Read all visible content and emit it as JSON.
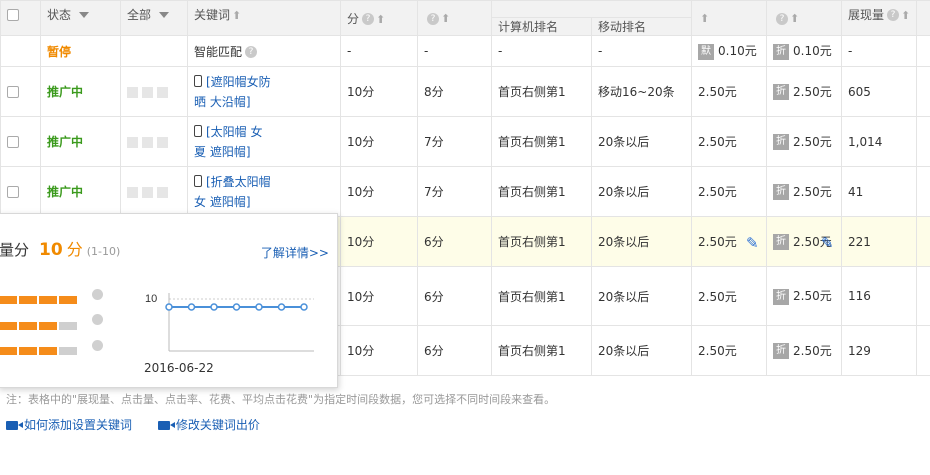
{
  "header": {
    "status": "状态",
    "all": "全部",
    "keyword": "关键词",
    "score": "分",
    "pc_rank": "计算机排名",
    "mobile_rank": "移动排名",
    "impressions": "展现量"
  },
  "rows": [
    {
      "status": "暂停",
      "keyword": "智能匹配",
      "pc_score": "-",
      "mobile_score": "-",
      "pc_rank": "-",
      "mobile_rank": "-",
      "pc_bid_tag": "默",
      "pc_bid": "0.10元",
      "mobile_bid_tag": "折",
      "mobile_bid": "0.10元",
      "impressions": "-"
    },
    {
      "status": "推广中",
      "keyword": "[遮阳帽女防晒 大沿帽]",
      "pc_score": "10分",
      "mobile_score": "8分",
      "pc_rank": "首页右侧第1",
      "mobile_rank": "移动16~20条",
      "pc_bid": "2.50元",
      "mobile_bid_tag": "折",
      "mobile_bid": "2.50元",
      "impressions": "605"
    },
    {
      "status": "推广中",
      "keyword": "[太阳帽 女夏 遮阳帽]",
      "pc_score": "10分",
      "mobile_score": "7分",
      "pc_rank": "首页右侧第1",
      "mobile_rank": "20条以后",
      "pc_bid": "2.50元",
      "mobile_bid_tag": "折",
      "mobile_bid": "2.50元",
      "impressions": "1,014"
    },
    {
      "status": "推广中",
      "keyword": "[折叠太阳帽女 遮阳帽]",
      "pc_score": "10分",
      "mobile_score": "7分",
      "pc_rank": "首页右侧第1",
      "mobile_rank": "20条以后",
      "pc_bid": "2.50元",
      "mobile_bid_tag": "折",
      "mobile_bid": "2.50元",
      "impressions": "41"
    },
    {
      "status": "",
      "keyword": "",
      "pc_score": "10分",
      "mobile_score": "6分",
      "pc_rank": "首页右侧第1",
      "mobile_rank": "20条以后",
      "pc_bid": "2.50元",
      "mobile_bid_tag": "折",
      "mobile_bid": "2.50元",
      "impressions": "221"
    },
    {
      "status": "",
      "keyword": "",
      "pc_score": "10分",
      "mobile_score": "6分",
      "pc_rank": "首页右侧第1",
      "mobile_rank": "20条以后",
      "pc_bid": "2.50元",
      "mobile_bid_tag": "折",
      "mobile_bid": "2.50元",
      "impressions": "116"
    },
    {
      "status": "",
      "keyword": "",
      "pc_score": "10分",
      "mobile_score": "6分",
      "pc_rank": "首页右侧第1",
      "mobile_rank": "20条以后",
      "pc_bid": "2.50元",
      "mobile_bid_tag": "折",
      "mobile_bid": "2.50元",
      "impressions": "129"
    }
  ],
  "footer": {
    "note": "注：表格中的\"展现量、点击量、点击率、花费、平均点击花费\"为指定时间段数据，您可选择不同时间段来查看。",
    "link_add": "如何添加设置关键词",
    "link_bid": "修改关键词出价"
  },
  "popup": {
    "title": "量分",
    "score": "10",
    "unit": "分",
    "range": "(1-10)",
    "detail_link": "了解详情>>",
    "bars": [
      {
        "filled": 4,
        "total": 4
      },
      {
        "filled": 3,
        "total": 4
      },
      {
        "filled": 3,
        "total": 4
      }
    ],
    "chart_data": {
      "type": "line",
      "x": [
        "2016-06-22",
        "",
        "",
        "",
        "",
        "",
        ""
      ],
      "series": [
        {
          "values": [
            10,
            10,
            10,
            10,
            10,
            10,
            10
          ]
        }
      ],
      "ytick": "10",
      "xlabel_visible": "2016-06-22",
      "ylim": [
        0,
        10
      ],
      "color": "#4a90d9"
    }
  },
  "colors": {
    "accent_orange": "#f08a00",
    "running_green": "#3b9a1d",
    "link_blue": "#1a5fb4"
  }
}
